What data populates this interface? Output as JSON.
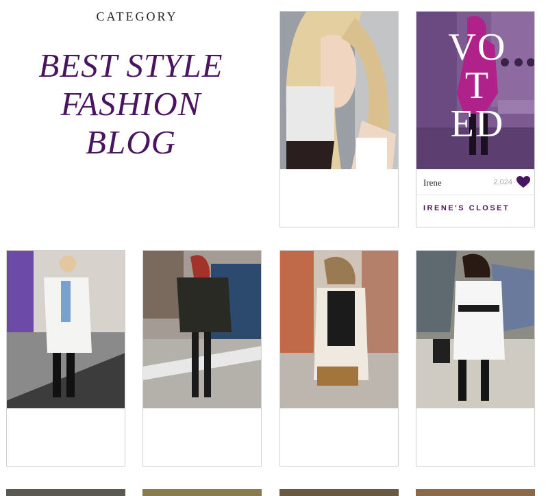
{
  "header": {
    "category_label": "CATEGORY",
    "title_line1": "BEST STYLE",
    "title_line2": "FASHION",
    "title_line3": "BLOG"
  },
  "featured": {
    "overlay_letters": [
      "VO",
      "T",
      "ED"
    ],
    "author": "Irene",
    "likes": "2,024",
    "closet_label": "IRENE'S CLOSET"
  },
  "colors": {
    "accent": "#4a1560"
  }
}
